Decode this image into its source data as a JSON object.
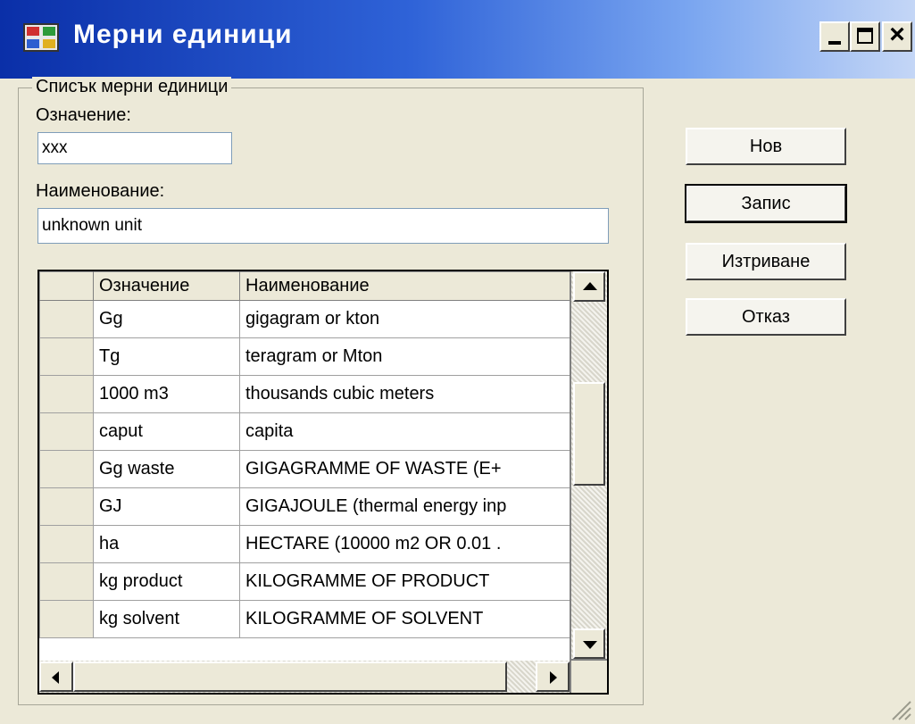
{
  "window": {
    "title": "Мерни единици",
    "controls": [
      "minimize-icon",
      "maximize-icon",
      "close-icon"
    ],
    "title_gradient": [
      "#0a2fa8",
      "#2f63d8",
      "#c4d6f6"
    ]
  },
  "group": {
    "legend": "Списък мерни единици",
    "code_label": "Означение:",
    "code_value": "xxx",
    "name_label": "Наименование:",
    "name_value": "unknown unit"
  },
  "grid": {
    "columns": [
      "Означение",
      "Наименование"
    ],
    "rows": [
      {
        "code": "Gg",
        "name": "gigagram or kton"
      },
      {
        "code": "Tg",
        "name": "teragram or Mton"
      },
      {
        "code": "1000 m3",
        "name": "thousands cubic meters"
      },
      {
        "code": "caput",
        "name": "capita"
      },
      {
        "code": "Gg waste",
        "name": "GIGAGRAMME OF WASTE (E+"
      },
      {
        "code": "GJ",
        "name": "GIGAJOULE (thermal energy inp"
      },
      {
        "code": "ha",
        "name": "HECTARE (10000 m2 OR 0.01 ."
      },
      {
        "code": "kg product",
        "name": "KILOGRAMME OF PRODUCT"
      },
      {
        "code": "kg solvent",
        "name": "KILOGRAMME OF SOLVENT"
      }
    ]
  },
  "buttons": {
    "new": "Нов",
    "save": "Запис",
    "delete": "Изтриване",
    "cancel": "Отказ"
  }
}
